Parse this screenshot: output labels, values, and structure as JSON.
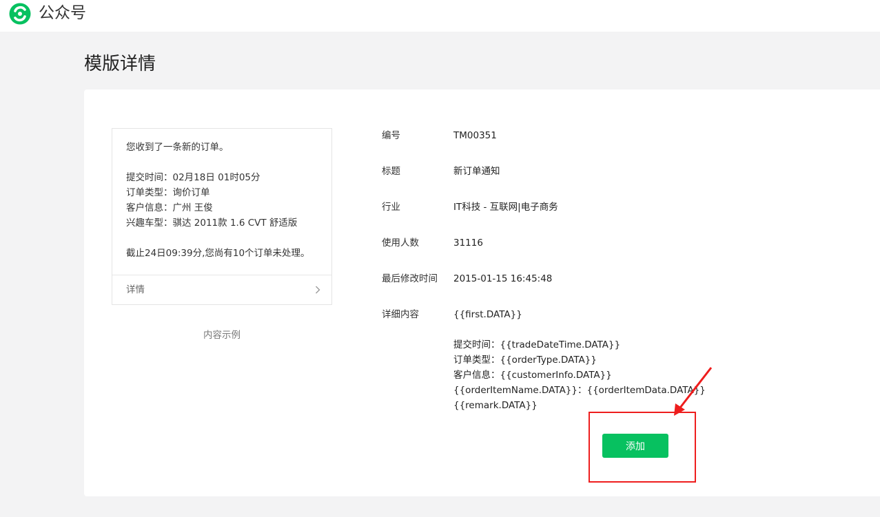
{
  "header": {
    "brand": "公众号",
    "logo_icon": "wechat-official-account-logo",
    "accent": "#07c160"
  },
  "page": {
    "title": "模版详情"
  },
  "preview": {
    "lines": [
      "您收到了一条新的订单。",
      "",
      "提交时间：02月18日 01时05分",
      "订单类型：询价订单",
      "客户信息：广州 王俊",
      "兴趣车型：骐达 2011款 1.6 CVT 舒适版",
      "",
      "截止24日09:39分,您尚有10个订单未处理。"
    ],
    "detail_label": "详情",
    "caption": "内容示例"
  },
  "info": {
    "id_label": "编号",
    "id_value": "TM00351",
    "title_label": "标题",
    "title_value": "新订单通知",
    "industry_label": "行业",
    "industry_value": "IT科技 - 互联网|电子商务",
    "users_label": "使用人数",
    "users_value": "31116",
    "modified_label": "最后修改时间",
    "modified_value": "2015-01-15 16:45:48",
    "content_label": "详细内容",
    "content_lines": [
      "{{first.DATA}}",
      "",
      "提交时间：{{tradeDateTime.DATA}}",
      "订单类型：{{orderType.DATA}}",
      "客户信息：{{customerInfo.DATA}}",
      "{{orderItemName.DATA}}：{{orderItemData.DATA}}",
      "{{remark.DATA}}"
    ]
  },
  "actions": {
    "add_label": "添加"
  },
  "annotation": {
    "color": "#ee1d1d"
  }
}
